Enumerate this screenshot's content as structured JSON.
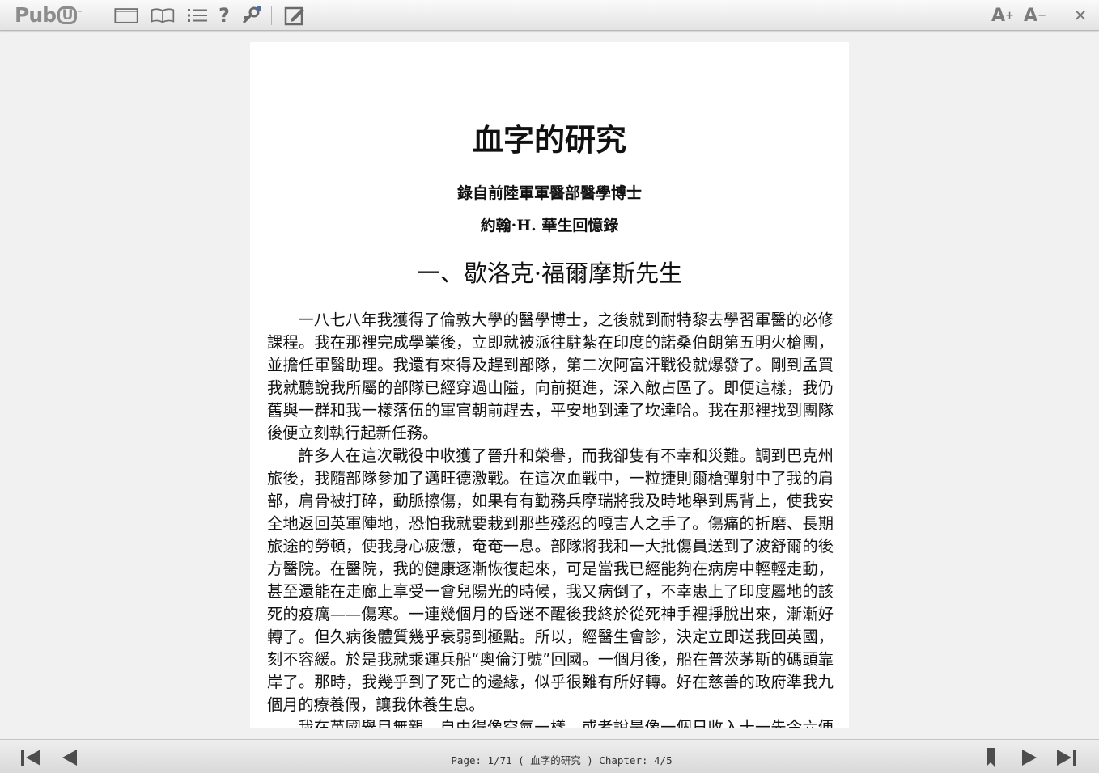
{
  "app": {
    "logo_text": "Pub",
    "logo_badge": "U",
    "logo_mark": "ˉ"
  },
  "toolbar": {
    "buttons": [
      {
        "icon": "single-page-icon",
        "tooltip": ""
      },
      {
        "icon": "book-icon",
        "tooltip": ""
      },
      {
        "icon": "list-icon",
        "tooltip": ""
      },
      {
        "icon": "help-icon",
        "glyph": "?"
      },
      {
        "icon": "settings-tools-icon"
      },
      {
        "icon": "edit-note-icon"
      }
    ],
    "font_increase": {
      "label": "A",
      "sup": "+"
    },
    "font_decrease": {
      "label": "A",
      "sup": "−"
    },
    "close_glyph": "✕"
  },
  "book": {
    "title": "血字的研究",
    "subtitle_1": "錄自前陸軍軍醫部醫學博士",
    "subtitle_2": "約翰·H. 華生回憶錄",
    "chapter_title": "一、歇洛克·福爾摩斯先生",
    "paragraphs": [
      "一八七八年我獲得了倫敦大學的醫學博士，之後就到耐特黎去學習軍醫的必修課程。我在那裡完成學業後，立即就被派往駐紮在印度的諾桑伯朗第五明火槍團，並擔任軍醫助理。我還有來得及趕到部隊，第二次阿富汗戰役就爆發了。剛到孟買我就聽說我所屬的部隊已經穿過山隘，向前挺進，深入敵占區了。即便這樣，我仍舊與一群和我一樣落伍的軍官朝前趕去，平安地到達了坎達哈。我在那裡找到團隊後便立刻執行起新任務。",
      "許多人在這次戰役中收獲了晉升和榮譽，而我卻隻有不幸和災難。調到巴克州旅後，我隨部隊參加了邁旺德激戰。在這次血戰中，一粒捷則爾槍彈射中了我的肩部，肩骨被打碎，動脈擦傷，如果有有勤務兵摩瑞將我及時地舉到馬背上，使我安全地返回英軍陣地，恐怕我就要栽到那些殘忍的嘎吉人之手了。傷痛的折磨、長期旅途的勞頓，使我身心疲憊，奄奄一息。部隊將我和一大批傷員送到了波舒爾的後方醫院。在醫院，我的健康逐漸恢復起來，可是當我已經能夠在病房中輕輕走動，甚至還能在走廊上享受一會兒陽光的時候，我又病倒了，不幸患上了印度屬地的該死的疫癘——傷寒。一連幾個月的昏迷不醒後我終於從死神手裡掙脫出來，漸漸好轉了。但久病後體質幾乎衰弱到極點。所以，經醫生會診，決定立即送我回英國，刻不容緩。於是我就乘運兵船“奧倫汀號”回國。一個月後，船在普茨茅斯的碼頭靠岸了。那時，我幾乎到了死亡的邊緣，似乎很難有所好轉。好在慈善的政府準我九個月的療養假，讓我休養生息。",
      "我在英國舉目無親，自由得像空氣一樣，或者說是像一個日收入十一先令六便士的人那樣悠然自得。於是，我幾乎身不由己地被吸引進倫敦這個泥淖中，大"
    ]
  },
  "status": {
    "page_info": "Page: 1/71 ( 血字的研究 ) Chapter: 4/5"
  }
}
